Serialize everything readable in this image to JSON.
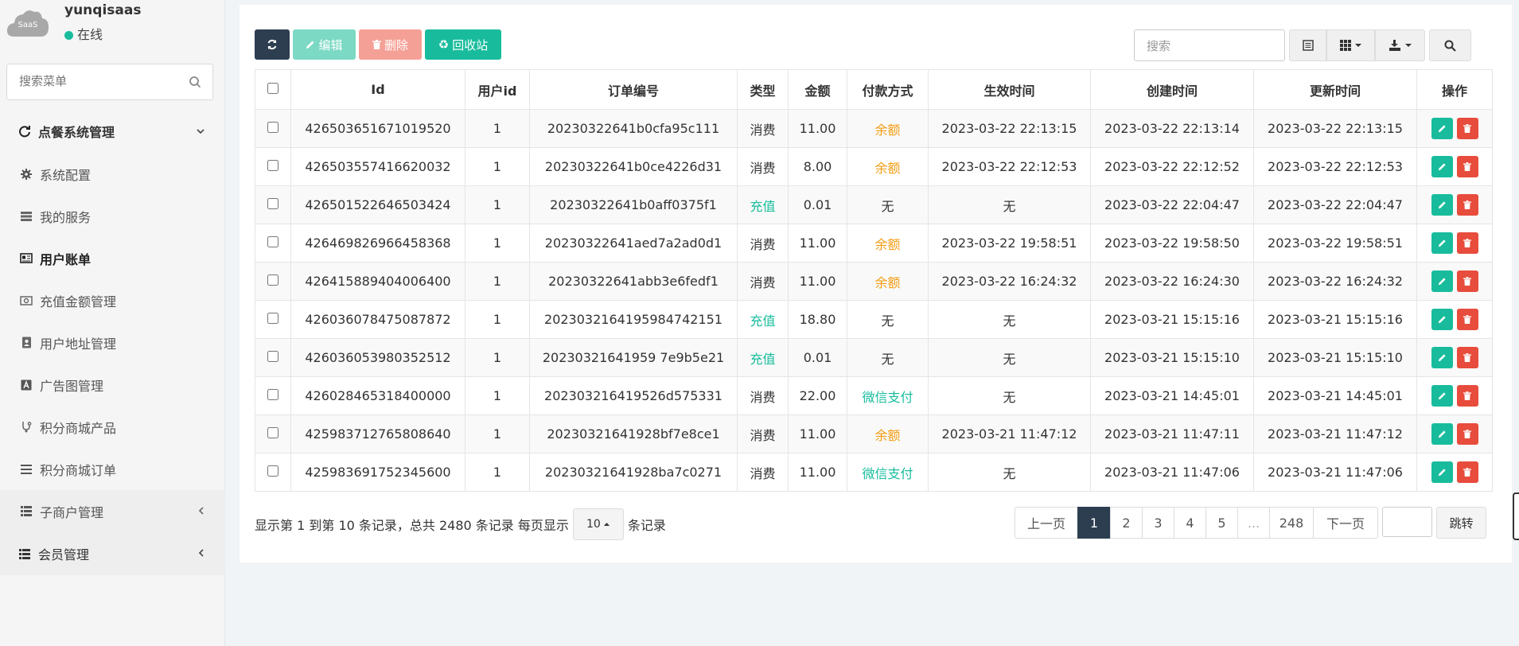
{
  "user": {
    "avatar_text": "SaaS",
    "name": "yunqisaas",
    "status": "在线"
  },
  "search_menu": {
    "placeholder": "搜索菜单"
  },
  "sidebar": {
    "items": [
      {
        "label": "点餐系统管理",
        "icon": "refresh-circle-icon"
      },
      {
        "label": "系统配置",
        "icon": "gear-icon"
      },
      {
        "label": "我的服务",
        "icon": "server-icon"
      },
      {
        "label": "用户账单",
        "icon": "newspaper-icon"
      },
      {
        "label": "充值金额管理",
        "icon": "money-icon"
      },
      {
        "label": "用户地址管理",
        "icon": "address-book-icon"
      },
      {
        "label": "广告图管理",
        "icon": "font-icon"
      },
      {
        "label": "积分商城产品",
        "icon": "product-icon"
      },
      {
        "label": "积分商城订单",
        "icon": "bars-icon"
      },
      {
        "label": "子商户管理",
        "icon": "list-icon"
      },
      {
        "label": "会员管理",
        "icon": "list-icon"
      }
    ]
  },
  "toolbar": {
    "edit_label": "编辑",
    "delete_label": "删除",
    "recycle_label": "回收站"
  },
  "table_search": {
    "placeholder": "搜索"
  },
  "table": {
    "headers": [
      "Id",
      "用户id",
      "订单编号",
      "类型",
      "金额",
      "付款方式",
      "生效时间",
      "创建时间",
      "更新时间",
      "操作"
    ],
    "rows": [
      {
        "id": "426503651671019520",
        "uid": "1",
        "order": "20230322641b0cfa95c111",
        "type": "消费",
        "amount": "11.00",
        "pay": "余额",
        "effective": "2023-03-22 22:13:15",
        "created": "2023-03-22 22:13:14",
        "updated": "2023-03-22 22:13:15"
      },
      {
        "id": "426503557416620032",
        "uid": "1",
        "order": "20230322641b0ce4226d31",
        "type": "消费",
        "amount": "8.00",
        "pay": "余额",
        "effective": "2023-03-22 22:12:53",
        "created": "2023-03-22 22:12:52",
        "updated": "2023-03-22 22:12:53"
      },
      {
        "id": "426501522646503424",
        "uid": "1",
        "order": "20230322641b0aff0375f1",
        "type": "充值",
        "amount": "0.01",
        "pay": "无",
        "effective": "无",
        "created": "2023-03-22 22:04:47",
        "updated": "2023-03-22 22:04:47"
      },
      {
        "id": "426469826966458368",
        "uid": "1",
        "order": "20230322641aed7a2ad0d1",
        "type": "消费",
        "amount": "11.00",
        "pay": "余额",
        "effective": "2023-03-22 19:58:51",
        "created": "2023-03-22 19:58:50",
        "updated": "2023-03-22 19:58:51"
      },
      {
        "id": "426415889404006400",
        "uid": "1",
        "order": "20230322641abb3e6fedf1",
        "type": "消费",
        "amount": "11.00",
        "pay": "余额",
        "effective": "2023-03-22 16:24:32",
        "created": "2023-03-22 16:24:30",
        "updated": "2023-03-22 16:24:32"
      },
      {
        "id": "426036078475087872",
        "uid": "1",
        "order": "202303216419598474215‌1",
        "type": "充值",
        "amount": "18.80",
        "pay": "无",
        "effective": "无",
        "created": "2023-03-21 15:15:16",
        "updated": "2023-03-21 15:15:16"
      },
      {
        "id": "426036053980352512",
        "uid": "1",
        "order": "20230321641959 7e9b5e21",
        "type": "充值",
        "amount": "0.01",
        "pay": "无",
        "effective": "无",
        "created": "2023-03-21 15:15:10",
        "updated": "2023-03-21 15:15:10"
      },
      {
        "id": "426028465318400000",
        "uid": "1",
        "order": "202303216419526d575331",
        "type": "消费",
        "amount": "22.00",
        "pay": "微信支付",
        "effective": "无",
        "created": "2023-03-21 14:45:01",
        "updated": "2023-03-21 14:45:01"
      },
      {
        "id": "425983712765808640",
        "uid": "1",
        "order": "20230321641928bf7e8ce1",
        "type": "消费",
        "amount": "11.00",
        "pay": "余额",
        "effective": "2023-03-21 11:47:12",
        "created": "2023-03-21 11:47:11",
        "updated": "2023-03-21 11:47:12"
      },
      {
        "id": "425983691752345600",
        "uid": "1",
        "order": "20230321641928ba7c0271",
        "type": "消费",
        "amount": "11.00",
        "pay": "微信支付",
        "effective": "无",
        "created": "2023-03-21 11:47:06",
        "updated": "2023-03-21 11:47:06"
      }
    ]
  },
  "footer": {
    "info_prefix": "显示第 1 到第 10 条记录，总共 2480 条记录 每页显示",
    "page_size": "10",
    "info_suffix": "条记录"
  },
  "pagination": {
    "prev": "上一页",
    "pages": [
      "1",
      "2",
      "3",
      "4",
      "5",
      "...",
      "248"
    ],
    "current": "1",
    "next": "下一页",
    "jump": "跳转"
  },
  "colors": {
    "primary_dark": "#2c3e50",
    "success": "#18bc9c",
    "danger": "#e74c3c",
    "warning": "#f39c12"
  }
}
